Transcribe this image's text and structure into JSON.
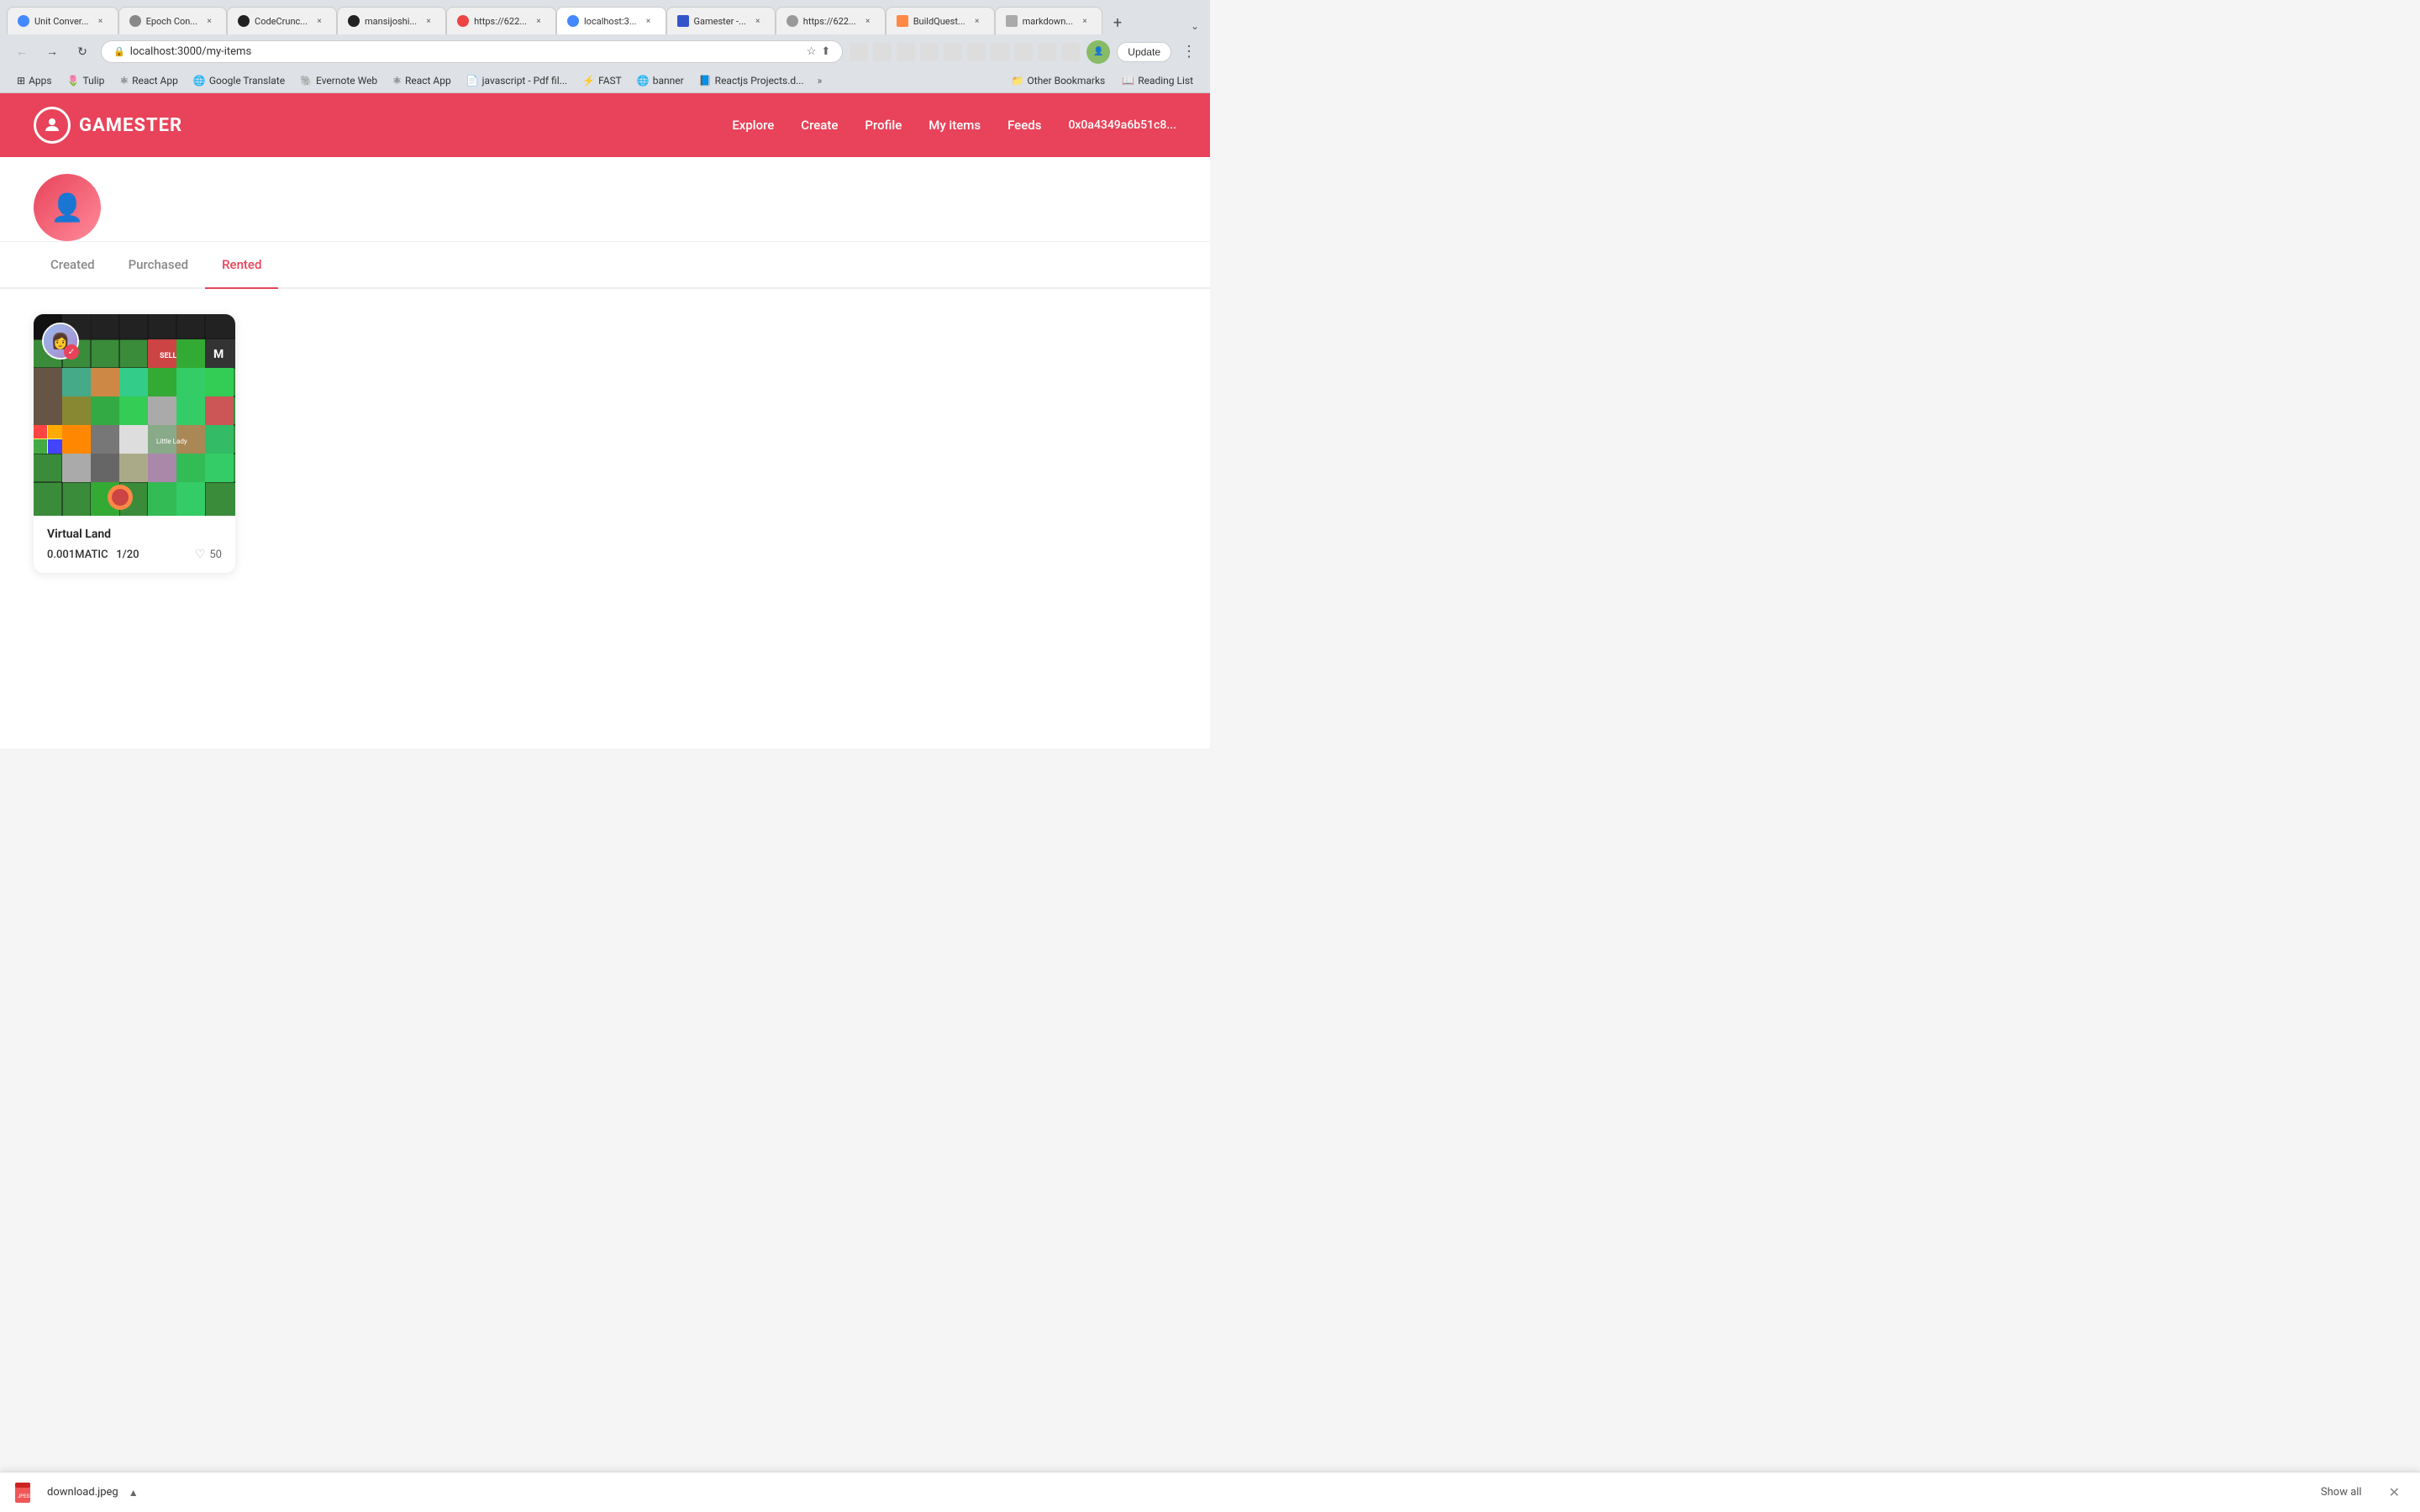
{
  "browser": {
    "tabs": [
      {
        "id": "tab1",
        "title": "Unit Conver...",
        "favicon": "🔵",
        "active": false
      },
      {
        "id": "tab2",
        "title": "Epoch Con...",
        "favicon": "⭕",
        "active": false
      },
      {
        "id": "tab3",
        "title": "CodeCrunc...",
        "favicon": "🐙",
        "active": false
      },
      {
        "id": "tab4",
        "title": "mansijoshi...",
        "favicon": "🐙",
        "active": false
      },
      {
        "id": "tab5",
        "title": "https://622...",
        "favicon": "🔴",
        "active": false
      },
      {
        "id": "tab6",
        "title": "localhost:3...",
        "favicon": "🌐",
        "active": true
      },
      {
        "id": "tab7",
        "title": "Gamester -...",
        "favicon": "📘",
        "active": false
      },
      {
        "id": "tab8",
        "title": "https://622...",
        "favicon": "🕸",
        "active": false
      },
      {
        "id": "tab9",
        "title": "BuildQuest...",
        "favicon": "🟧",
        "active": false
      },
      {
        "id": "tab10",
        "title": "markdown...",
        "favicon": "📄",
        "active": false
      }
    ],
    "address": "localhost:3000/my-items",
    "update_label": "Update"
  },
  "bookmarks": [
    {
      "id": "bm1",
      "title": "Apps",
      "favicon": "⚙"
    },
    {
      "id": "bm2",
      "title": "Tulip",
      "favicon": "🌷"
    },
    {
      "id": "bm3",
      "title": "React App",
      "favicon": "⚛"
    },
    {
      "id": "bm4",
      "title": "Google Translate",
      "favicon": "🌐"
    },
    {
      "id": "bm5",
      "title": "Evernote Web",
      "favicon": "🐘"
    },
    {
      "id": "bm6",
      "title": "React App",
      "favicon": "⚛"
    },
    {
      "id": "bm7",
      "title": "javascript - Pdf fil...",
      "favicon": "📄"
    },
    {
      "id": "bm8",
      "title": "FAST",
      "favicon": "⚡"
    },
    {
      "id": "bm9",
      "title": "banner",
      "favicon": "🌐"
    },
    {
      "id": "bm10",
      "title": "Reactjs Projects.d...",
      "favicon": "📘"
    }
  ],
  "bookmarks_right": [
    {
      "id": "bm11",
      "title": "Other Bookmarks",
      "icon": "📁"
    },
    {
      "id": "bm12",
      "title": "Reading List",
      "icon": "📖"
    }
  ],
  "site": {
    "logo_text": "GAMESTER",
    "nav_links": [
      "Explore",
      "Create",
      "Profile",
      "My items",
      "Feeds"
    ],
    "wallet": "0x0a4349a6b51c8..."
  },
  "page": {
    "tabs": [
      {
        "id": "created",
        "label": "Created",
        "active": false
      },
      {
        "id": "purchased",
        "label": "Purchased",
        "active": false
      },
      {
        "id": "rented",
        "label": "Rented",
        "active": true
      }
    ]
  },
  "nft_card": {
    "name": "Virtual Land",
    "price": "0.001MATIC",
    "edition": "1/20",
    "likes": "50"
  },
  "download_bar": {
    "filename": "download.jpeg",
    "show_all": "Show all"
  }
}
